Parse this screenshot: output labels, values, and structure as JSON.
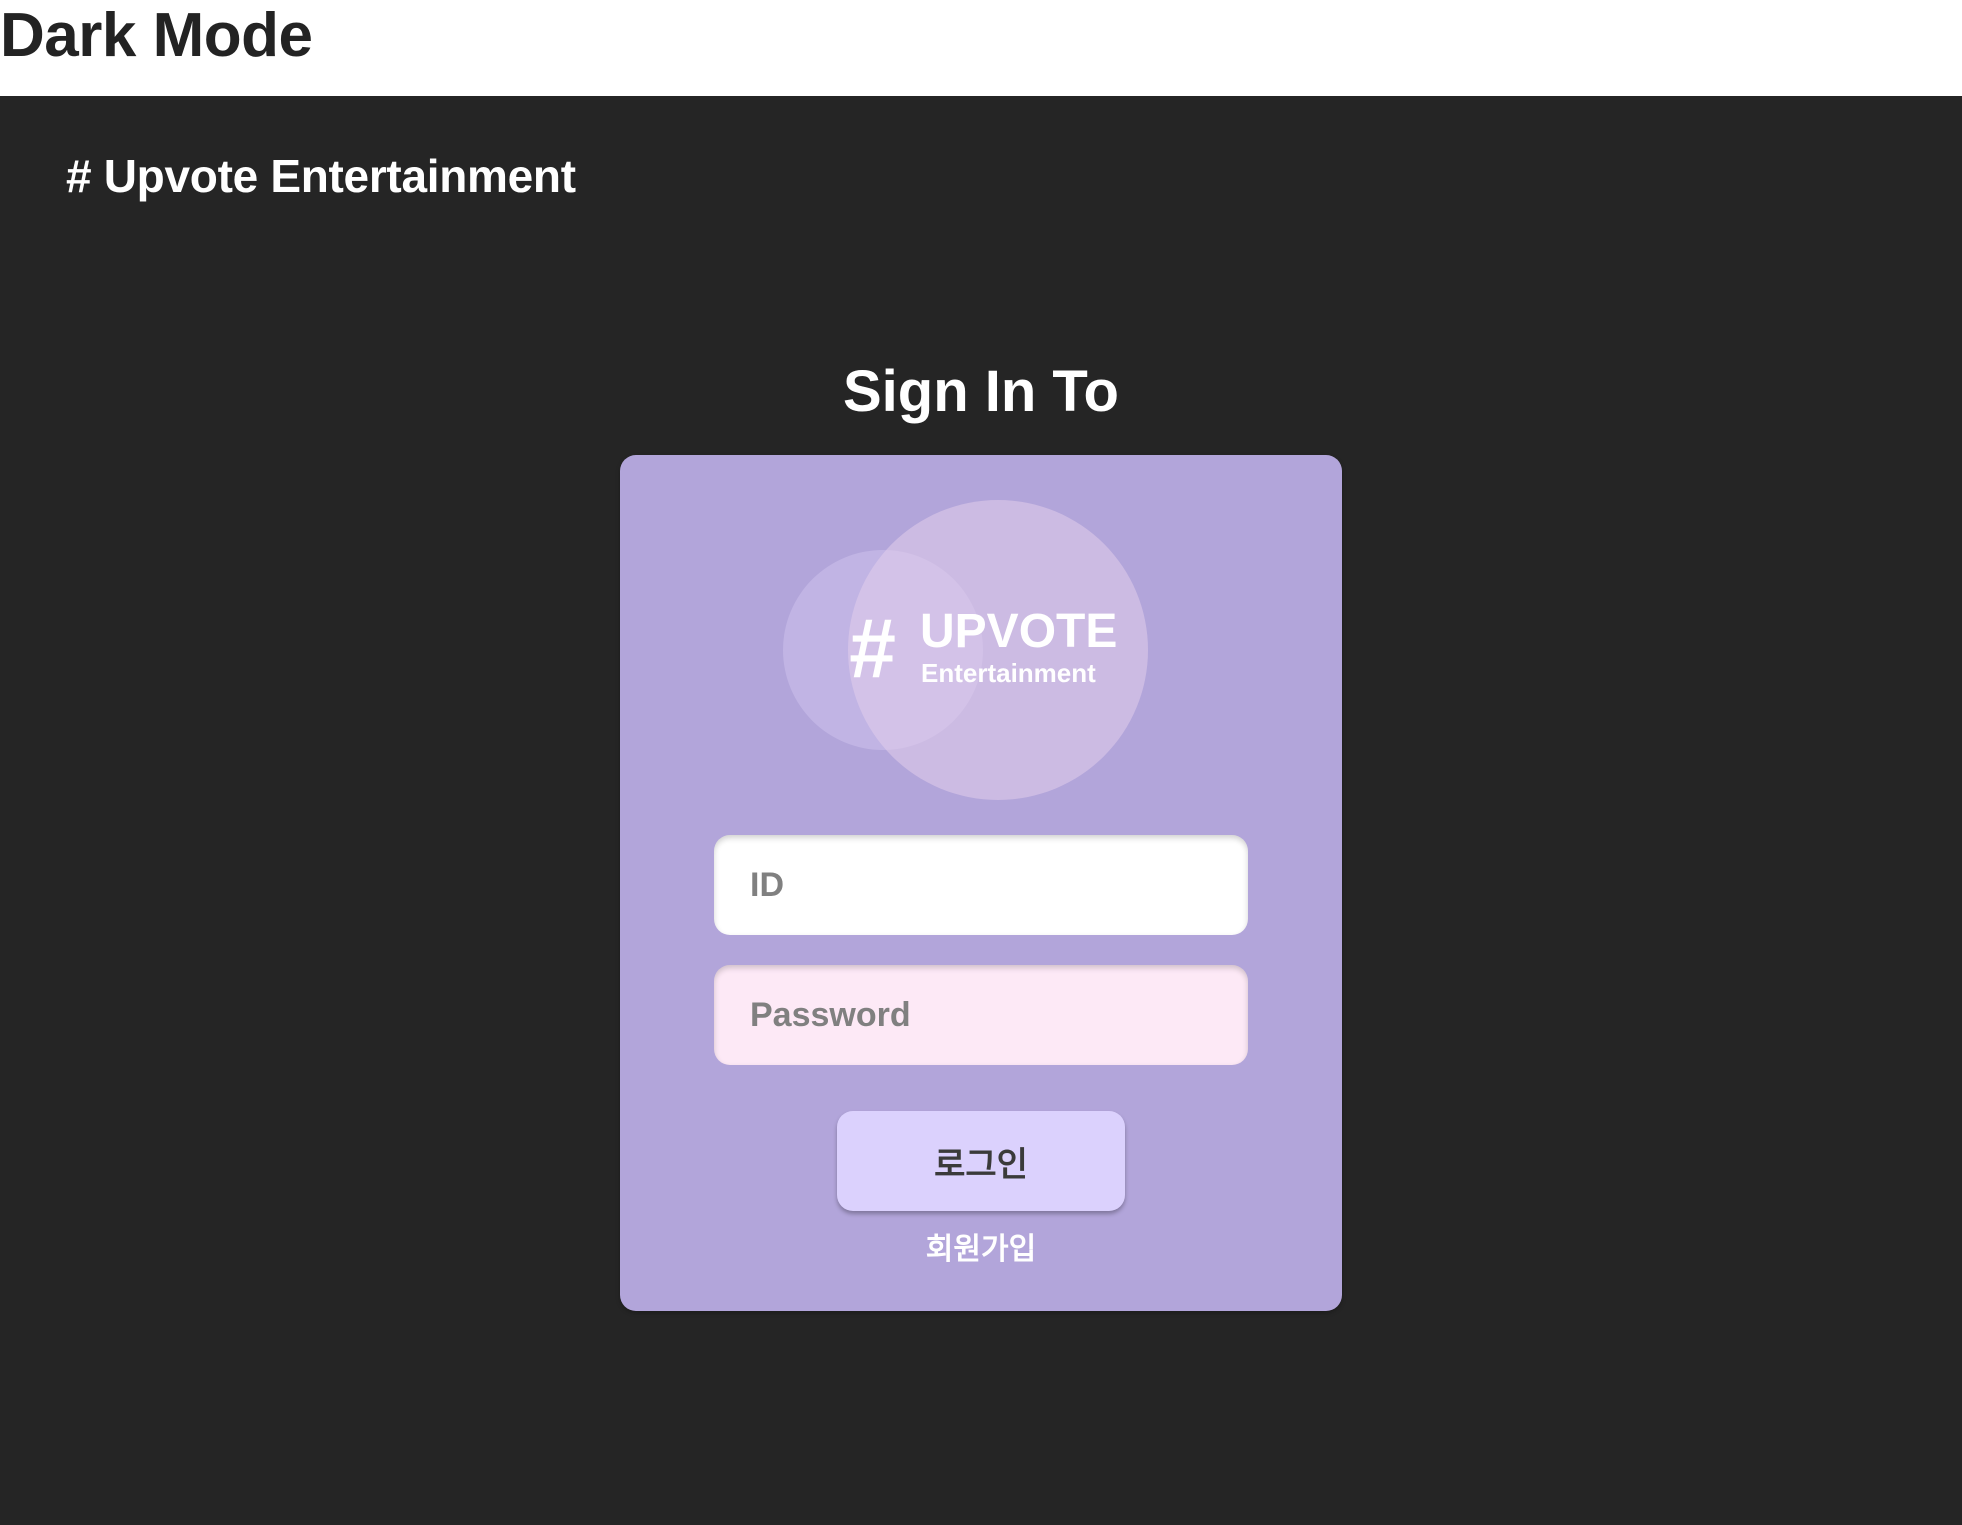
{
  "header": {
    "title": "Dark Mode"
  },
  "brand": {
    "text": "# Upvote Entertainment"
  },
  "signin": {
    "heading": "Sign In To"
  },
  "logo": {
    "hash": "#",
    "word": "UPVOTE",
    "sub": "Entertainment"
  },
  "form": {
    "id_placeholder": "ID",
    "password_placeholder": "Password",
    "login_label": "로그인",
    "signup_label": "회원가입"
  },
  "colors": {
    "header_bg": "#ffffff",
    "dark_bg": "#252525",
    "card_bg": "#b2a5da",
    "id_field_bg": "#ffffff",
    "password_field_bg": "#fde9f6",
    "login_button_bg": "#dbd1fd"
  }
}
